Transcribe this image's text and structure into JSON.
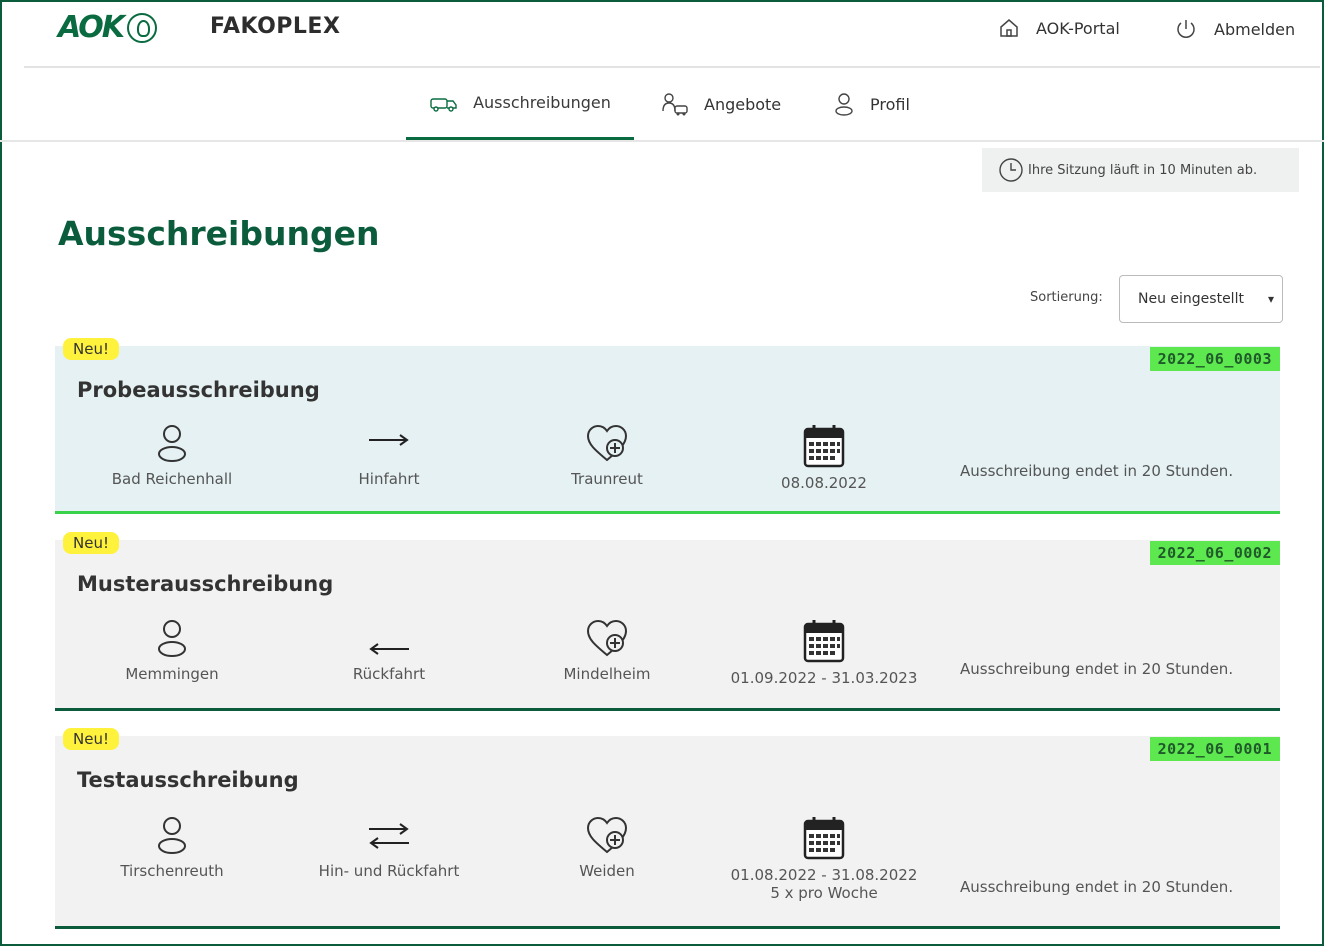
{
  "header": {
    "logo_text": "AOK",
    "app_title": "FAKOPLEX",
    "portal_label": "AOK-Portal",
    "logout_label": "Abmelden"
  },
  "nav": {
    "items": [
      {
        "label": "Ausschreibungen",
        "icon": "truck-icon",
        "active": true
      },
      {
        "label": "Angebote",
        "icon": "offers-icon",
        "active": false
      },
      {
        "label": "Profil",
        "icon": "user-icon",
        "active": false
      }
    ]
  },
  "session": {
    "text": "Ihre Sitzung läuft in 10 Minuten ab."
  },
  "page": {
    "title": "Ausschreibungen"
  },
  "sort": {
    "label": "Sortierung:",
    "selected": "Neu eingestellt"
  },
  "colors": {
    "accent": "#0a5c3c",
    "new_badge": "#fff23c",
    "code_badge": "#5ee84f",
    "highlight_border": "#3ad24b"
  },
  "tenders": [
    {
      "badge": "Neu!",
      "code": "2022_06_0003",
      "title": "Probeausschreibung",
      "from": "Bad Reichenhall",
      "direction": "Hinfahrt",
      "direction_icon": "arrow-right-icon",
      "destination": "Traunreut",
      "date": "08.08.2022",
      "frequency": "",
      "ends": "Ausschreibung endet in 20 Stunden."
    },
    {
      "badge": "Neu!",
      "code": "2022_06_0002",
      "title": "Musterausschreibung",
      "from": "Memmingen",
      "direction": "Rückfahrt",
      "direction_icon": "arrow-left-icon",
      "destination": "Mindelheim",
      "date": "01.09.2022 - 31.03.2023",
      "frequency": "",
      "ends": "Ausschreibung endet in 20 Stunden."
    },
    {
      "badge": "Neu!",
      "code": "2022_06_0001",
      "title": "Testausschreibung",
      "from": "Tirschenreuth",
      "direction": "Hin- und Rückfahrt",
      "direction_icon": "arrows-both-icon",
      "destination": "Weiden",
      "date": "01.08.2022 - 31.08.2022",
      "frequency": "5 x pro Woche",
      "ends": "Ausschreibung endet in 20 Stunden."
    }
  ]
}
